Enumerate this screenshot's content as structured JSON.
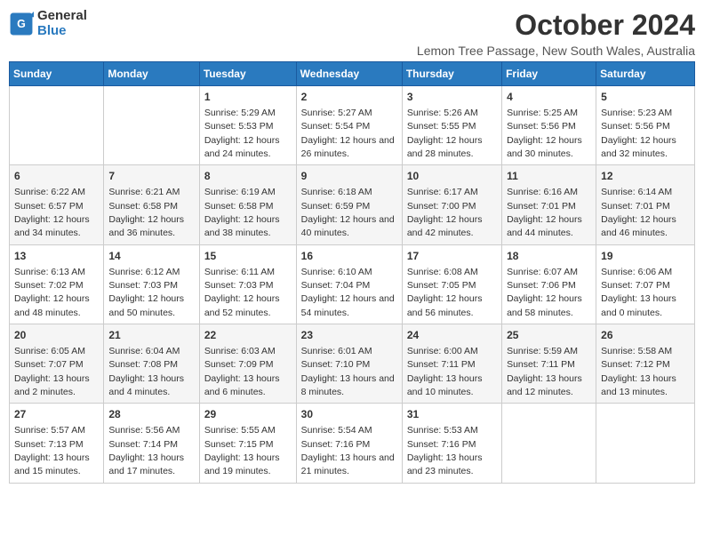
{
  "header": {
    "logo_line1": "General",
    "logo_line2": "Blue",
    "month": "October 2024",
    "location": "Lemon Tree Passage, New South Wales, Australia"
  },
  "days_of_week": [
    "Sunday",
    "Monday",
    "Tuesday",
    "Wednesday",
    "Thursday",
    "Friday",
    "Saturday"
  ],
  "weeks": [
    [
      {
        "num": "",
        "sunrise": "",
        "sunset": "",
        "daylight": ""
      },
      {
        "num": "",
        "sunrise": "",
        "sunset": "",
        "daylight": ""
      },
      {
        "num": "1",
        "sunrise": "Sunrise: 5:29 AM",
        "sunset": "Sunset: 5:53 PM",
        "daylight": "Daylight: 12 hours and 24 minutes."
      },
      {
        "num": "2",
        "sunrise": "Sunrise: 5:27 AM",
        "sunset": "Sunset: 5:54 PM",
        "daylight": "Daylight: 12 hours and 26 minutes."
      },
      {
        "num": "3",
        "sunrise": "Sunrise: 5:26 AM",
        "sunset": "Sunset: 5:55 PM",
        "daylight": "Daylight: 12 hours and 28 minutes."
      },
      {
        "num": "4",
        "sunrise": "Sunrise: 5:25 AM",
        "sunset": "Sunset: 5:56 PM",
        "daylight": "Daylight: 12 hours and 30 minutes."
      },
      {
        "num": "5",
        "sunrise": "Sunrise: 5:23 AM",
        "sunset": "Sunset: 5:56 PM",
        "daylight": "Daylight: 12 hours and 32 minutes."
      }
    ],
    [
      {
        "num": "6",
        "sunrise": "Sunrise: 6:22 AM",
        "sunset": "Sunset: 6:57 PM",
        "daylight": "Daylight: 12 hours and 34 minutes."
      },
      {
        "num": "7",
        "sunrise": "Sunrise: 6:21 AM",
        "sunset": "Sunset: 6:58 PM",
        "daylight": "Daylight: 12 hours and 36 minutes."
      },
      {
        "num": "8",
        "sunrise": "Sunrise: 6:19 AM",
        "sunset": "Sunset: 6:58 PM",
        "daylight": "Daylight: 12 hours and 38 minutes."
      },
      {
        "num": "9",
        "sunrise": "Sunrise: 6:18 AM",
        "sunset": "Sunset: 6:59 PM",
        "daylight": "Daylight: 12 hours and 40 minutes."
      },
      {
        "num": "10",
        "sunrise": "Sunrise: 6:17 AM",
        "sunset": "Sunset: 7:00 PM",
        "daylight": "Daylight: 12 hours and 42 minutes."
      },
      {
        "num": "11",
        "sunrise": "Sunrise: 6:16 AM",
        "sunset": "Sunset: 7:01 PM",
        "daylight": "Daylight: 12 hours and 44 minutes."
      },
      {
        "num": "12",
        "sunrise": "Sunrise: 6:14 AM",
        "sunset": "Sunset: 7:01 PM",
        "daylight": "Daylight: 12 hours and 46 minutes."
      }
    ],
    [
      {
        "num": "13",
        "sunrise": "Sunrise: 6:13 AM",
        "sunset": "Sunset: 7:02 PM",
        "daylight": "Daylight: 12 hours and 48 minutes."
      },
      {
        "num": "14",
        "sunrise": "Sunrise: 6:12 AM",
        "sunset": "Sunset: 7:03 PM",
        "daylight": "Daylight: 12 hours and 50 minutes."
      },
      {
        "num": "15",
        "sunrise": "Sunrise: 6:11 AM",
        "sunset": "Sunset: 7:03 PM",
        "daylight": "Daylight: 12 hours and 52 minutes."
      },
      {
        "num": "16",
        "sunrise": "Sunrise: 6:10 AM",
        "sunset": "Sunset: 7:04 PM",
        "daylight": "Daylight: 12 hours and 54 minutes."
      },
      {
        "num": "17",
        "sunrise": "Sunrise: 6:08 AM",
        "sunset": "Sunset: 7:05 PM",
        "daylight": "Daylight: 12 hours and 56 minutes."
      },
      {
        "num": "18",
        "sunrise": "Sunrise: 6:07 AM",
        "sunset": "Sunset: 7:06 PM",
        "daylight": "Daylight: 12 hours and 58 minutes."
      },
      {
        "num": "19",
        "sunrise": "Sunrise: 6:06 AM",
        "sunset": "Sunset: 7:07 PM",
        "daylight": "Daylight: 13 hours and 0 minutes."
      }
    ],
    [
      {
        "num": "20",
        "sunrise": "Sunrise: 6:05 AM",
        "sunset": "Sunset: 7:07 PM",
        "daylight": "Daylight: 13 hours and 2 minutes."
      },
      {
        "num": "21",
        "sunrise": "Sunrise: 6:04 AM",
        "sunset": "Sunset: 7:08 PM",
        "daylight": "Daylight: 13 hours and 4 minutes."
      },
      {
        "num": "22",
        "sunrise": "Sunrise: 6:03 AM",
        "sunset": "Sunset: 7:09 PM",
        "daylight": "Daylight: 13 hours and 6 minutes."
      },
      {
        "num": "23",
        "sunrise": "Sunrise: 6:01 AM",
        "sunset": "Sunset: 7:10 PM",
        "daylight": "Daylight: 13 hours and 8 minutes."
      },
      {
        "num": "24",
        "sunrise": "Sunrise: 6:00 AM",
        "sunset": "Sunset: 7:11 PM",
        "daylight": "Daylight: 13 hours and 10 minutes."
      },
      {
        "num": "25",
        "sunrise": "Sunrise: 5:59 AM",
        "sunset": "Sunset: 7:11 PM",
        "daylight": "Daylight: 13 hours and 12 minutes."
      },
      {
        "num": "26",
        "sunrise": "Sunrise: 5:58 AM",
        "sunset": "Sunset: 7:12 PM",
        "daylight": "Daylight: 13 hours and 13 minutes."
      }
    ],
    [
      {
        "num": "27",
        "sunrise": "Sunrise: 5:57 AM",
        "sunset": "Sunset: 7:13 PM",
        "daylight": "Daylight: 13 hours and 15 minutes."
      },
      {
        "num": "28",
        "sunrise": "Sunrise: 5:56 AM",
        "sunset": "Sunset: 7:14 PM",
        "daylight": "Daylight: 13 hours and 17 minutes."
      },
      {
        "num": "29",
        "sunrise": "Sunrise: 5:55 AM",
        "sunset": "Sunset: 7:15 PM",
        "daylight": "Daylight: 13 hours and 19 minutes."
      },
      {
        "num": "30",
        "sunrise": "Sunrise: 5:54 AM",
        "sunset": "Sunset: 7:16 PM",
        "daylight": "Daylight: 13 hours and 21 minutes."
      },
      {
        "num": "31",
        "sunrise": "Sunrise: 5:53 AM",
        "sunset": "Sunset: 7:16 PM",
        "daylight": "Daylight: 13 hours and 23 minutes."
      },
      {
        "num": "",
        "sunrise": "",
        "sunset": "",
        "daylight": ""
      },
      {
        "num": "",
        "sunrise": "",
        "sunset": "",
        "daylight": ""
      }
    ]
  ]
}
